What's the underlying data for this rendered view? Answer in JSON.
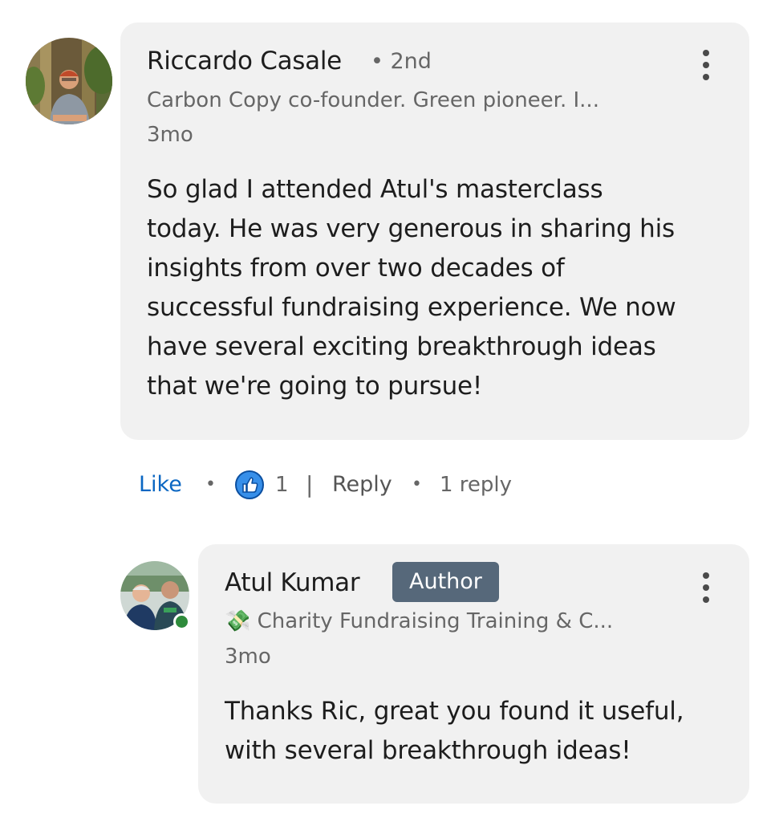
{
  "comment": {
    "author_name": "Riccardo Casale",
    "degree": "• 2nd",
    "headline": "Carbon Copy co-founder. Green pioneer. I...",
    "time": "3mo",
    "text": "So glad I attended Atul's masterclass today. He was very generous in sharing his insights from over two decades of successful fundraising experience. We now have several exciting breakthrough ideas that we're going to pursue!",
    "text_lines": [
      "So glad I attended Atul's masterclass",
      "today. He was very generous in sharing his",
      "insights from over two decades of",
      "successful fundraising experience. We now",
      "have several exciting breakthrough ideas",
      "that we're going to pursue!"
    ],
    "actions": {
      "like_label": "Like",
      "separator": "•",
      "reaction_icon": "thumbs-up-icon",
      "reaction_count": "1",
      "divider": "|",
      "reply_label": "Reply",
      "replies_label": "1 reply"
    }
  },
  "reply": {
    "author_name": "Atul Kumar",
    "badge": "Author",
    "headline": "💸 Charity Fundraising Training & C...",
    "time": "3mo",
    "text": "Thanks Ric, great you found it useful, with several breakthrough ideas!",
    "text_lines": [
      "Thanks Ric, great you found it useful,",
      "with several breakthrough ideas!"
    ]
  },
  "colors": {
    "link_blue": "#0a66c2",
    "bubble_bg": "#f1f1f1",
    "badge_bg": "#56687a",
    "online_green": "#2e8b3b",
    "like_icon_blue": "#378fe9"
  }
}
